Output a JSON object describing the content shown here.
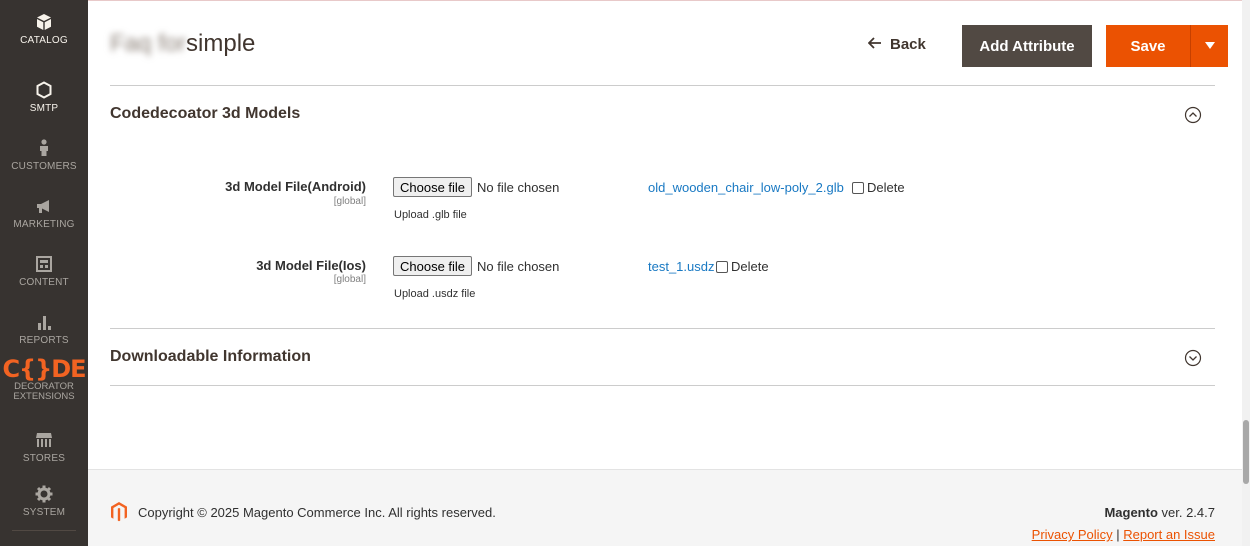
{
  "sidebar": {
    "items": [
      {
        "label": "CATALOG",
        "icon": "cube-icon"
      },
      {
        "label": "SMTP",
        "icon": "hexagon-icon"
      },
      {
        "label": "CUSTOMERS",
        "icon": "person-icon"
      },
      {
        "label": "MARKETING",
        "icon": "megaphone-icon"
      },
      {
        "label": "CONTENT",
        "icon": "layout-icon"
      },
      {
        "label": "REPORTS",
        "icon": "bar-chart-icon"
      },
      {
        "label": "STORES",
        "icon": "store-icon"
      },
      {
        "label": "SYSTEM",
        "icon": "gear-icon"
      }
    ],
    "extension_logo": {
      "code_text": "C{}DE",
      "sub_line1": "DECORATOR",
      "sub_line2": "EXTENSIONS"
    }
  },
  "header": {
    "title_obscured": "Faq for",
    "title": "simple",
    "back_label": "Back",
    "add_attribute_label": "Add Attribute",
    "save_label": "Save"
  },
  "sections": {
    "models": {
      "title": "Codedecoator 3d Models",
      "fields": [
        {
          "label": "3d Model File(Android)",
          "scope": "[global]",
          "button": "Choose file",
          "status": "No file chosen",
          "note": "Upload .glb file",
          "current_file": "old_wooden_chair_low-poly_2.glb",
          "delete_label": "Delete"
        },
        {
          "label": "3d Model File(Ios)",
          "scope": "[global]",
          "button": "Choose file",
          "status": "No file chosen",
          "note": "Upload .usdz file",
          "current_file": "test_1.usdz",
          "delete_label": "Delete"
        }
      ]
    },
    "downloadable": {
      "title": "Downloadable Information"
    }
  },
  "footer": {
    "copyright": "Copyright © 2025 Magento Commerce Inc. All rights reserved.",
    "brand": "Magento",
    "version": "ver. 2.4.7",
    "privacy_label": "Privacy Policy",
    "separator": "|",
    "report_label": "Report an Issue"
  },
  "colors": {
    "sidebar_bg": "#373330",
    "accent": "#eb5202",
    "secondary_button": "#514943",
    "link": "#1979c3"
  }
}
